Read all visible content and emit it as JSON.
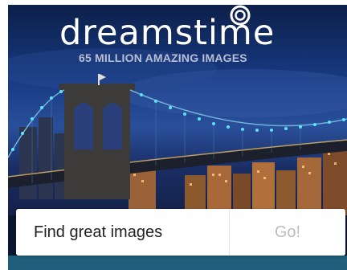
{
  "brand": {
    "name": "dreamstime",
    "tagline": "65 MILLION AMAZING IMAGES",
    "logo_icon": "swirl-icon"
  },
  "hero": {
    "image": "brooklyn-bridge-night-skyline"
  },
  "search": {
    "placeholder": "Find great images",
    "button_label": "Go!"
  },
  "colors": {
    "sky_top": "#0d1f4a",
    "bridge_lights": "#5ee6ff",
    "tagline": "#b9bfd3",
    "button_text": "#bdbdbd"
  }
}
